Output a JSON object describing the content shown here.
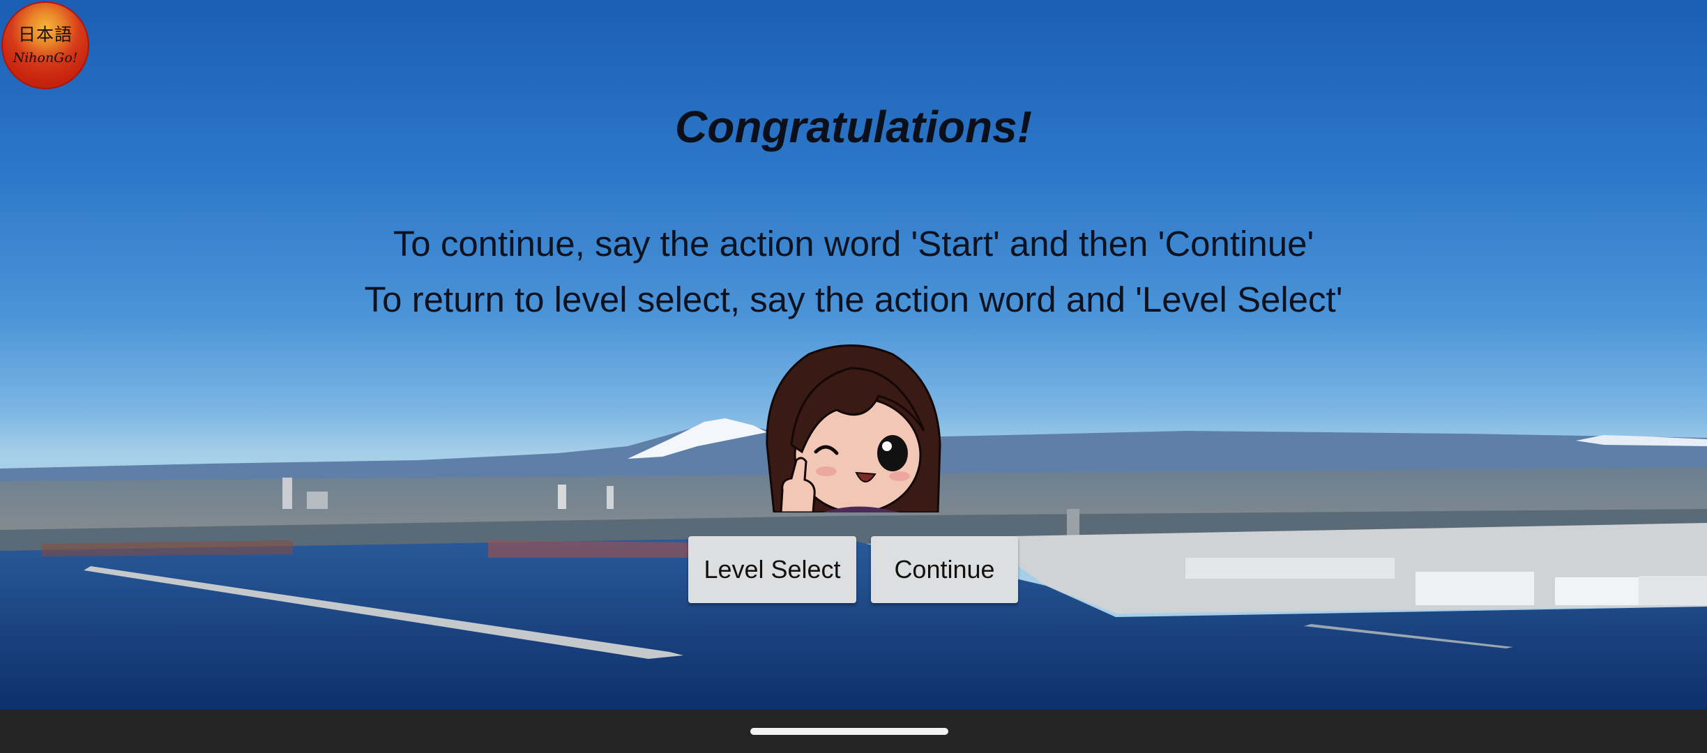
{
  "app": {
    "logo_kanji": "日本語",
    "logo_script": "NihonGo!"
  },
  "dialog": {
    "title": "Congratulations!",
    "instruction_continue": "To continue, say the action word 'Start' and then 'Continue'",
    "instruction_level_select": "To return to level select, say the action word and 'Level Select'"
  },
  "buttons": {
    "level_select_label": "Level Select",
    "continue_label": "Continue"
  },
  "colors": {
    "button_bg": "#dcdedf",
    "logo_red": "#c8240f",
    "navbar": "#242424"
  },
  "icons": [
    "mascot-wink-thumbs-up",
    "gesture-handle"
  ]
}
